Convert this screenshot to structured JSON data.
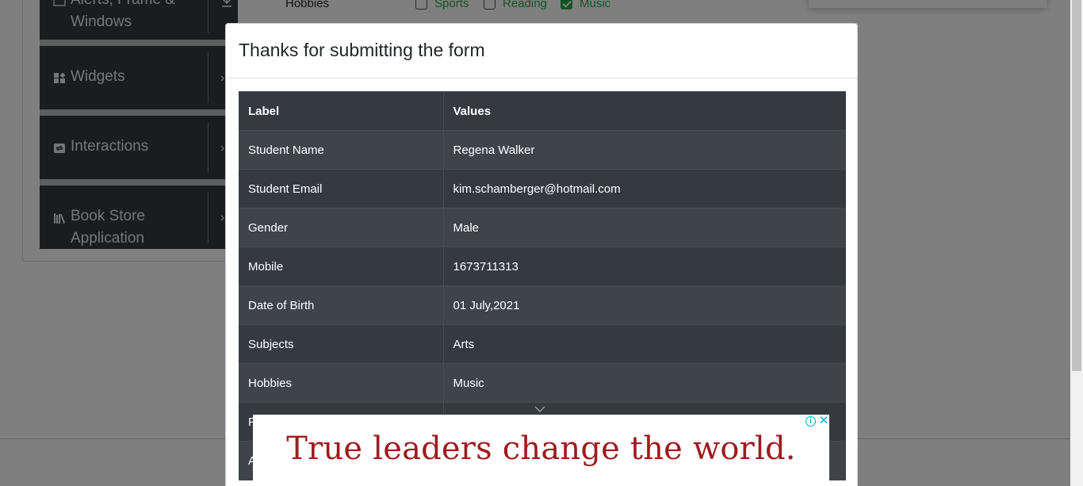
{
  "sidebar": {
    "groups": [
      {
        "label": "Alerts, Frame & Windows",
        "icon": "window-icon"
      },
      {
        "label": "Widgets",
        "icon": "widgets-icon"
      },
      {
        "label": "Interactions",
        "icon": "interactions-icon"
      },
      {
        "label": "Book Store Application",
        "icon": "bookstore-icon"
      }
    ]
  },
  "form_background": {
    "hobbies_label": "Hobbies",
    "options": [
      {
        "label": "Sports",
        "checked": false
      },
      {
        "label": "Reading",
        "checked": false
      },
      {
        "label": "Music",
        "checked": true
      }
    ]
  },
  "modal": {
    "title": "Thanks for submitting the form",
    "table": {
      "headers": [
        "Label",
        "Values"
      ],
      "rows": [
        [
          "Student Name",
          "Regena Walker"
        ],
        [
          "Student Email",
          "kim.schamberger@hotmail.com"
        ],
        [
          "Gender",
          "Male"
        ],
        [
          "Mobile",
          "1673711313"
        ],
        [
          "Date of Birth",
          "01 July,2021"
        ],
        [
          "Subjects",
          "Arts"
        ],
        [
          "Hobbies",
          "Music"
        ],
        [
          "P",
          ""
        ],
        [
          "A",
          ""
        ]
      ]
    }
  },
  "ad": {
    "text": "True leaders change the world.",
    "info_icon": "info-icon",
    "close_icon": "close-icon",
    "text_color": "#9e1b1f",
    "accent_color": "#00aecd"
  },
  "colors": {
    "table_dark": "#343a40",
    "table_stripe": "#3e444a",
    "checkbox_checked": "#28a745"
  }
}
